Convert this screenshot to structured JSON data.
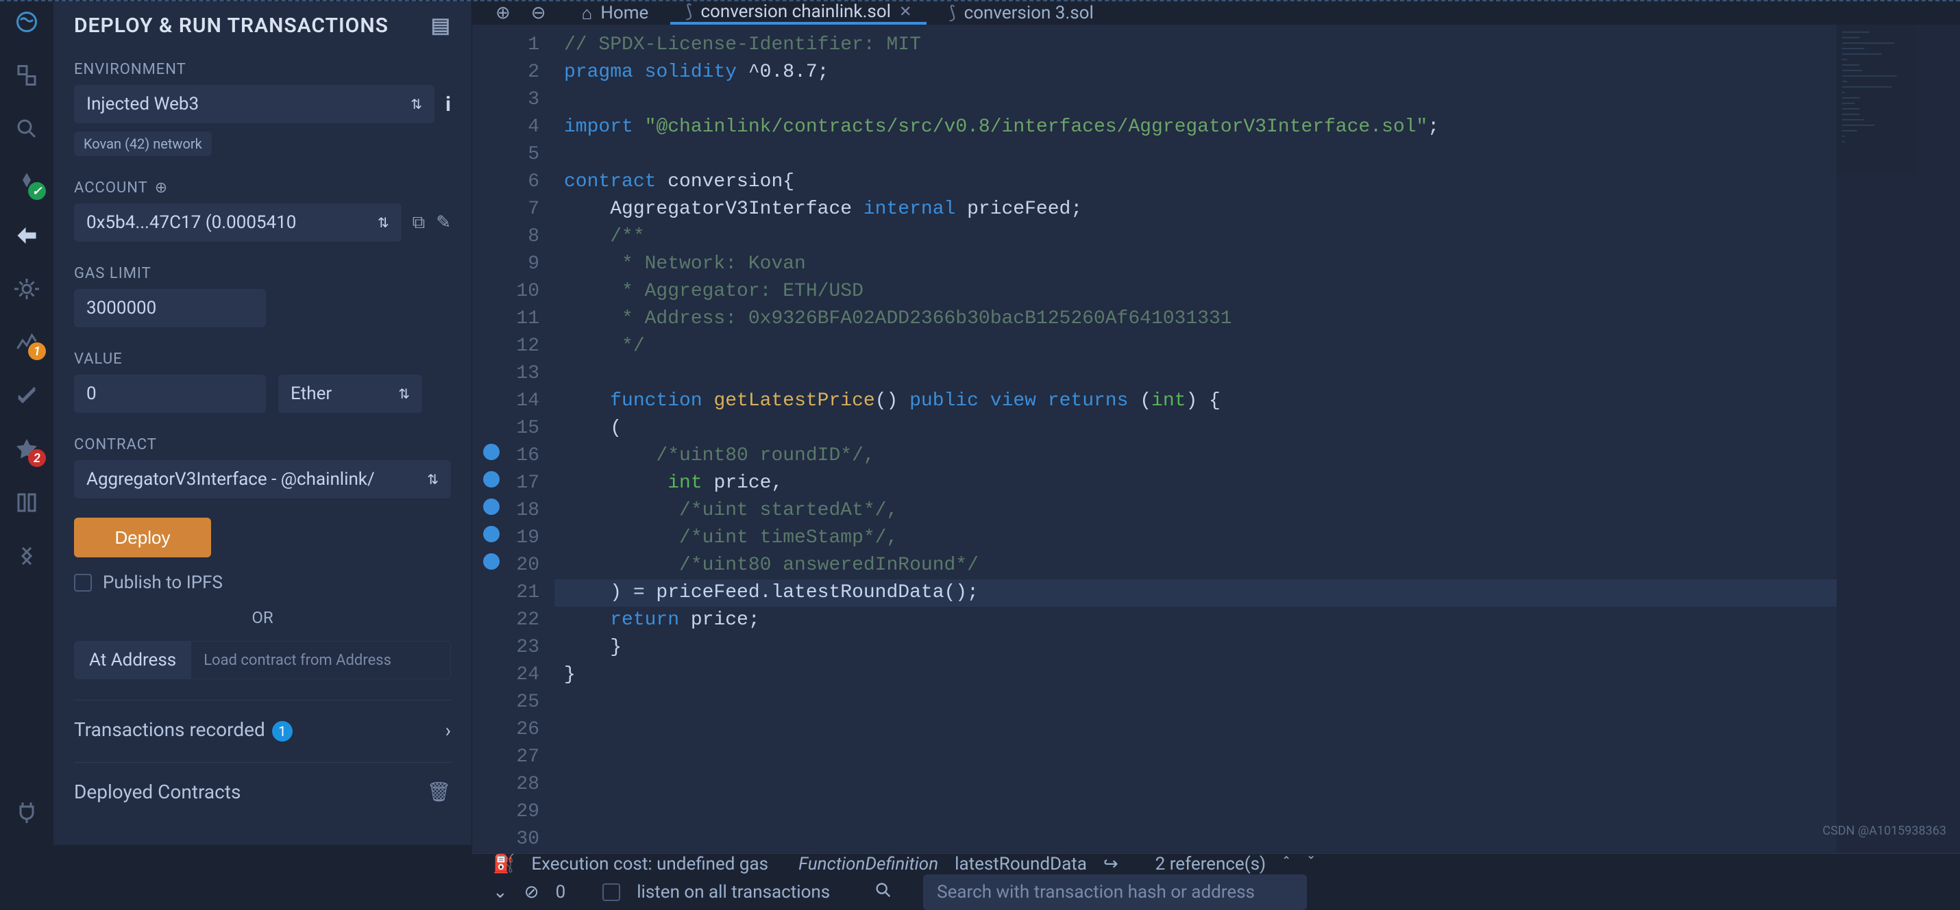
{
  "panel": {
    "title": "DEPLOY & RUN TRANSACTIONS",
    "env_label": "ENVIRONMENT",
    "env_value": "Injected Web3",
    "network_badge": "Kovan (42) network",
    "account_label": "ACCOUNT",
    "account_value": "0x5b4...47C17 (0.0005410",
    "gas_label": "GAS LIMIT",
    "gas_value": "3000000",
    "value_label": "VALUE",
    "value_value": "0",
    "value_unit": "Ether",
    "contract_label": "CONTRACT",
    "contract_value": "AggregatorV3Interface - @chainlink/",
    "deploy_btn": "Deploy",
    "publish_label": "Publish to IPFS",
    "or_label": "OR",
    "ataddr_btn": "At Address",
    "ataddr_placeholder": "Load contract from Address",
    "tx_recorded": "Transactions recorded",
    "tx_count": "1",
    "deployed_contracts": "Deployed Contracts"
  },
  "tabs": {
    "home": "Home",
    "active": "conversion chainlink.sol",
    "third": "conversion 3.sol"
  },
  "code": {
    "lines": [
      "// SPDX-License-Identifier: MIT",
      "pragma solidity ^0.8.7;",
      "",
      "import \"@chainlink/contracts/src/v0.8/interfaces/AggregatorV3Interface.sol\";",
      "",
      "contract conversion{",
      "    AggregatorV3Interface internal priceFeed;",
      "    /**",
      "     * Network: Kovan",
      "     * Aggregator: ETH/USD",
      "     * Address: 0x9326BFA02ADD2366b30bacB125260Af641031331",
      "     */",
      "",
      "    function getLatestPrice() public view returns (int) {",
      "    (",
      "        /*uint80 roundID*/,",
      "         int price,",
      "          /*uint startedAt*/,",
      "          /*uint timeStamp*/,",
      "          /*uint80 answeredInRound*/",
      "    ) = priceFeed.latestRoundData();",
      "    return price;",
      "    }",
      "}",
      "",
      "",
      "",
      "",
      "",
      ""
    ],
    "line_start": 1,
    "line_end": 30
  },
  "status": {
    "exec": "Execution cost: undefined gas",
    "def_kind": "FunctionDefinition",
    "def_name": "latestRoundData",
    "refs": "2 reference(s)"
  },
  "terminal": {
    "zero": "0",
    "listen": "listen on all transactions",
    "search_placeholder": "Search with transaction hash or address"
  },
  "watermark": "CSDN @A1015938363"
}
